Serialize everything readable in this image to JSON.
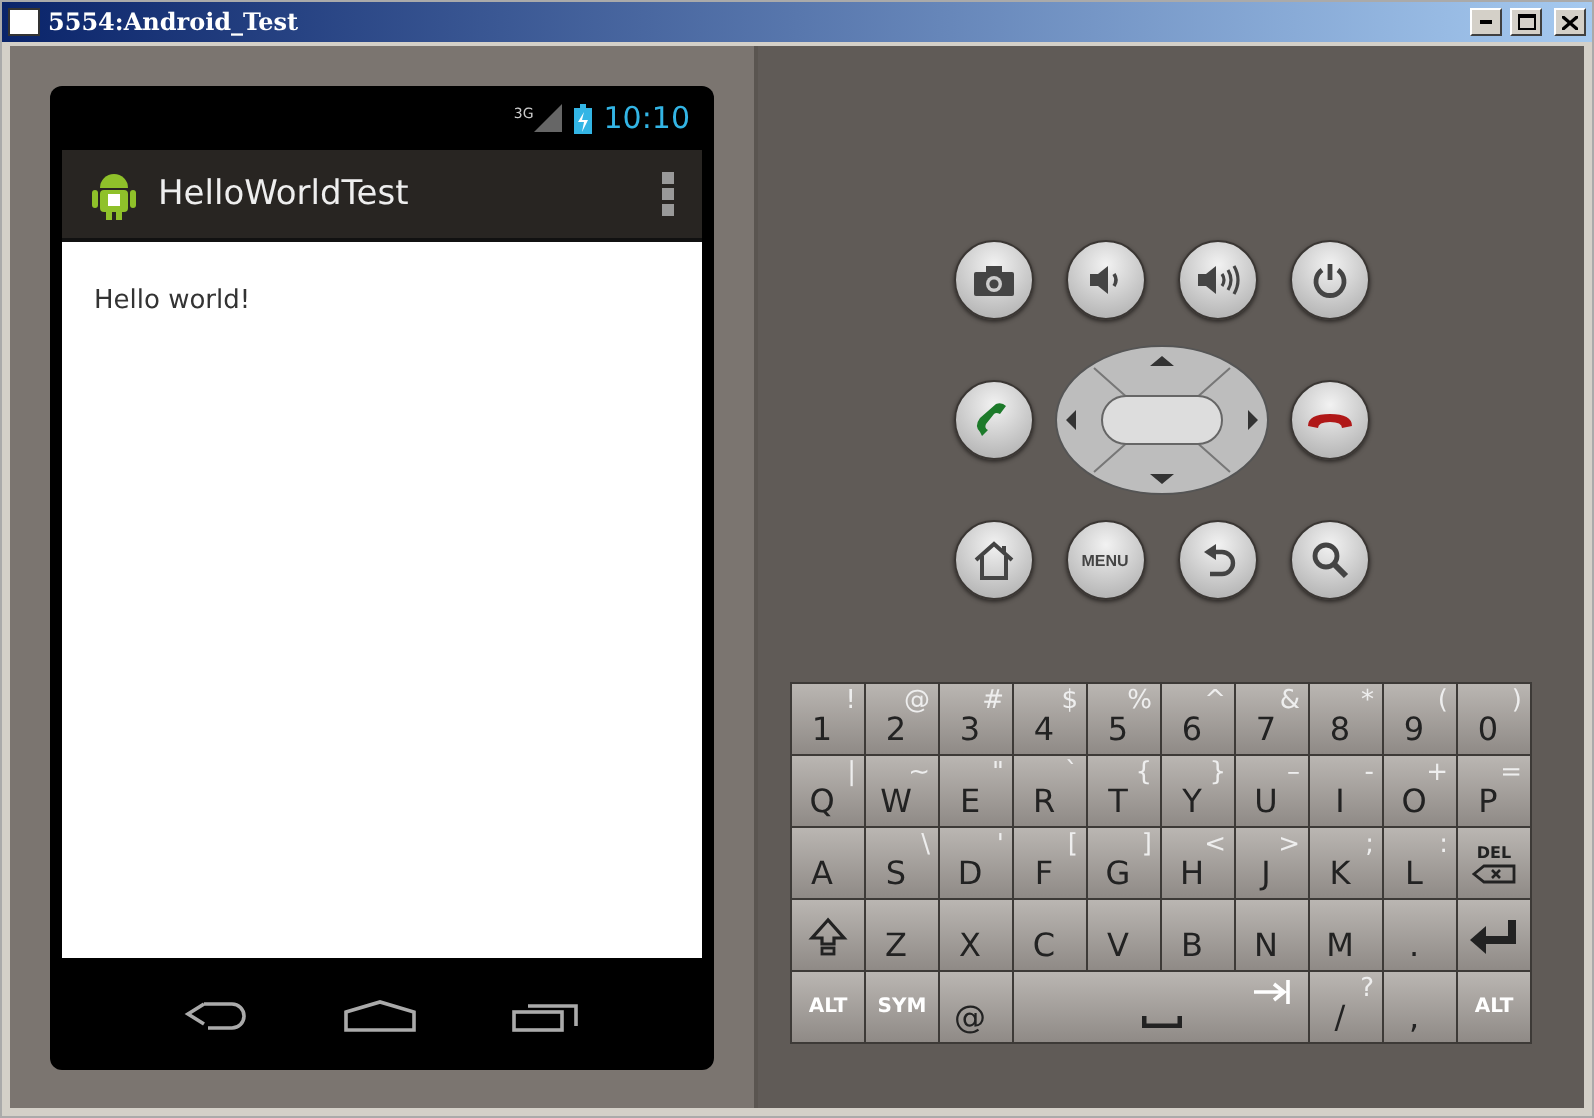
{
  "window": {
    "title": "5554:Android_Test"
  },
  "status_bar": {
    "network": "3G",
    "time": "10:10"
  },
  "action_bar": {
    "title": "HelloWorldTest"
  },
  "content": {
    "text": "Hello world!"
  },
  "hardware_buttons": [
    {
      "kind": "camera"
    },
    {
      "kind": "volume-down"
    },
    {
      "kind": "volume-up"
    },
    {
      "kind": "power"
    },
    {
      "kind": "call"
    },
    {
      "kind": "dpad"
    },
    {
      "kind": "end-call"
    },
    {
      "kind": "home"
    },
    {
      "kind": "menu",
      "label": "MENU"
    },
    {
      "kind": "back"
    },
    {
      "kind": "search"
    }
  ],
  "keyboard": {
    "keys": [
      {
        "kind": "char",
        "main": "1",
        "alt": "!"
      },
      {
        "kind": "char",
        "main": "2",
        "alt": "@"
      },
      {
        "kind": "char",
        "main": "3",
        "alt": "#"
      },
      {
        "kind": "char",
        "main": "4",
        "alt": "$"
      },
      {
        "kind": "char",
        "main": "5",
        "alt": "%"
      },
      {
        "kind": "char",
        "main": "6",
        "alt": "^"
      },
      {
        "kind": "char",
        "main": "7",
        "alt": "&"
      },
      {
        "kind": "char",
        "main": "8",
        "alt": "*"
      },
      {
        "kind": "char",
        "main": "9",
        "alt": "("
      },
      {
        "kind": "char",
        "main": "0",
        "alt": ")"
      },
      {
        "kind": "char",
        "main": "Q",
        "alt": "|"
      },
      {
        "kind": "char",
        "main": "W",
        "alt": "~"
      },
      {
        "kind": "char",
        "main": "E",
        "alt": "\""
      },
      {
        "kind": "char",
        "main": "R",
        "alt": "`"
      },
      {
        "kind": "char",
        "main": "T",
        "alt": "{"
      },
      {
        "kind": "char",
        "main": "Y",
        "alt": "}"
      },
      {
        "kind": "char",
        "main": "U",
        "alt": "–"
      },
      {
        "kind": "char",
        "main": "I",
        "alt": "-"
      },
      {
        "kind": "char",
        "main": "O",
        "alt": "+"
      },
      {
        "kind": "char",
        "main": "P",
        "alt": "="
      },
      {
        "kind": "char",
        "main": "A"
      },
      {
        "kind": "char",
        "main": "S",
        "alt": "\\"
      },
      {
        "kind": "char",
        "main": "D",
        "alt": "'"
      },
      {
        "kind": "char",
        "main": "F",
        "alt": "["
      },
      {
        "kind": "char",
        "main": "G",
        "alt": "]"
      },
      {
        "kind": "char",
        "main": "H",
        "alt": "<"
      },
      {
        "kind": "char",
        "main": "J",
        "alt": ">"
      },
      {
        "kind": "char",
        "main": "K",
        "alt": ";"
      },
      {
        "kind": "char",
        "main": "L",
        "alt": ":"
      },
      {
        "kind": "del",
        "main": "DEL"
      },
      {
        "kind": "shift"
      },
      {
        "kind": "char",
        "main": "Z"
      },
      {
        "kind": "char",
        "main": "X"
      },
      {
        "kind": "char",
        "main": "C"
      },
      {
        "kind": "char",
        "main": "V"
      },
      {
        "kind": "char",
        "main": "B"
      },
      {
        "kind": "char",
        "main": "N"
      },
      {
        "kind": "char",
        "main": "M"
      },
      {
        "kind": "char",
        "main": "."
      },
      {
        "kind": "enter"
      },
      {
        "kind": "mod",
        "main": "ALT"
      },
      {
        "kind": "mod",
        "main": "SYM"
      },
      {
        "kind": "char",
        "main": "@"
      },
      {
        "kind": "space"
      },
      {
        "kind": "char",
        "main": "/",
        "alt": "?"
      },
      {
        "kind": "char",
        "main": ","
      },
      {
        "kind": "mod",
        "main": "ALT"
      }
    ]
  }
}
